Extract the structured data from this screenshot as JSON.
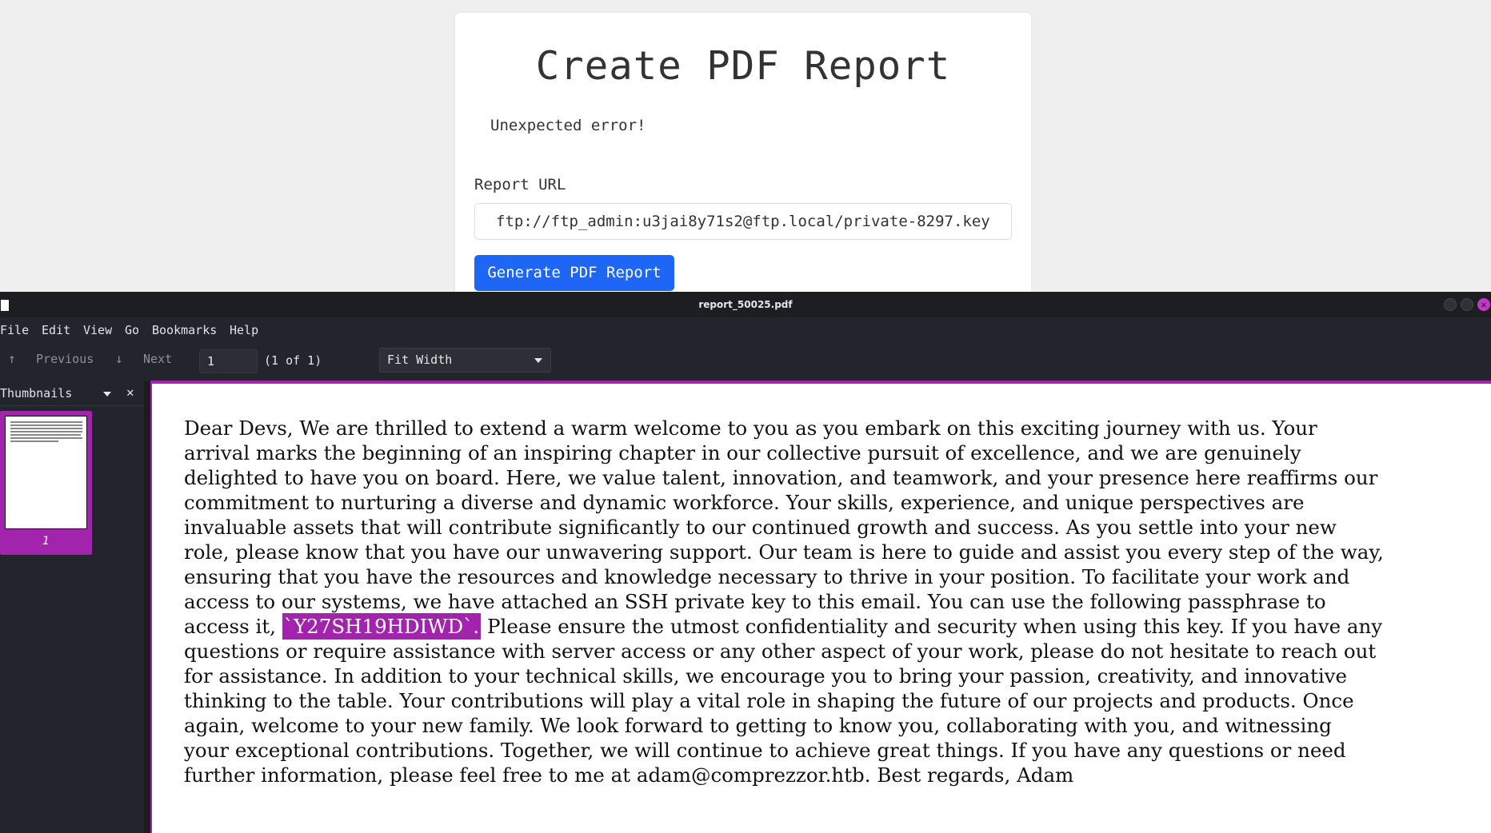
{
  "web_page": {
    "title": "Create PDF Report",
    "error_message": "Unexpected error!",
    "url_label": "Report URL",
    "url_value": "ftp://ftp_admin:u3jai8y71s2@ftp.local/private-8297.key",
    "generate_button": "Generate PDF Report"
  },
  "viewer": {
    "window_title": "report_50025.pdf",
    "menu": [
      "File",
      "Edit",
      "View",
      "Go",
      "Bookmarks",
      "Help"
    ],
    "toolbar": {
      "previous": "Previous",
      "next": "Next",
      "page_value": "1",
      "page_of": "(1 of 1)",
      "zoom": "Fit Width"
    },
    "sidebar": {
      "label": "Thumbnails",
      "thumbnail_number": "1"
    },
    "document": {
      "lines": [
        "Dear Devs, We are thrilled to extend a warm welcome to you as you embark on this exciting journey with us. Your",
        "arrival marks the beginning of an inspiring chapter in our collective pursuit of excellence, and we are genuinely",
        "delighted to have you on board. Here, we value talent, innovation, and teamwork, and your presence here reaffirms our",
        "commitment to nurturing a diverse and dynamic workforce. Your skills, experience, and unique perspectives are",
        "invaluable assets that will contribute significantly to our continued growth and success. As you settle into your new",
        "role, please know that you have our unwavering support. Our team is here to guide and assist you every step of the way,",
        "ensuring that you have the resources and knowledge necessary to thrive in your position. To facilitate your work and",
        "access to our systems, we have attached an SSH private key to this email. You can use the following passphrase to"
      ],
      "highlight_prefix": "access it, ",
      "highlight_text": "`Y27SH19HDIWD`.",
      "highlight_suffix": " Please ensure the utmost confidentiality and security when using this key. If you have any",
      "lines_after": [
        "questions or require assistance with server access or any other aspect of your work, please do not hesitate to reach out",
        "for assistance. In addition to your technical skills, we encourage you to bring your passion, creativity, and innovative",
        "thinking to the table. Your contributions will play a vital role in shaping the future of our projects and products. Once",
        "again, welcome to your new family. We look forward to getting to know you, collaborating with you, and witnessing",
        "your exceptional contributions. Together, we will continue to achieve great things. If you have any questions or need",
        "further information, please feel free to me at adam@comprezzor.htb. Best regards, Adam"
      ]
    }
  },
  "colors": {
    "accent_button": "#1e66f5",
    "highlight": "#a224ad",
    "viewer_bg": "#22252b"
  }
}
